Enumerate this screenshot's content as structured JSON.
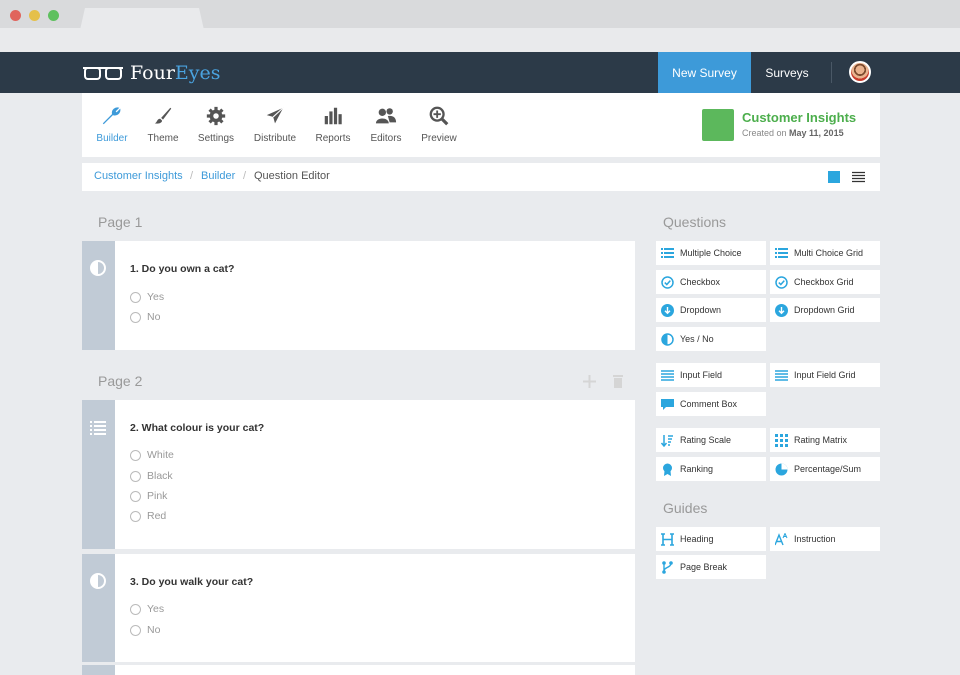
{
  "app": {
    "logo_main": "Four",
    "logo_accent": "Eyes"
  },
  "nav": {
    "new_survey": "New Survey",
    "surveys": "Surveys"
  },
  "toolbar": [
    {
      "label": "Builder",
      "icon": "wrench-icon",
      "active": true
    },
    {
      "label": "Theme",
      "icon": "brush-icon"
    },
    {
      "label": "Settings",
      "icon": "gear-icon"
    },
    {
      "label": "Distribute",
      "icon": "paper-plane-icon"
    },
    {
      "label": "Reports",
      "icon": "bar-chart-icon"
    },
    {
      "label": "Editors",
      "icon": "users-icon"
    },
    {
      "label": "Preview",
      "icon": "magnifier-icon"
    }
  ],
  "survey": {
    "title": "Customer Insights",
    "created_prefix": "Created on ",
    "created_date": "May 11, 2015",
    "color": "#5cb85c"
  },
  "breadcrumb": {
    "items": [
      "Customer Insights",
      "Builder",
      "Question Editor"
    ],
    "separator": "/"
  },
  "pages": [
    {
      "title": "Page 1"
    },
    {
      "title": "Page 2"
    }
  ],
  "questions": [
    {
      "title": "1.  Do you own a cat?",
      "icon": "half-circle-icon",
      "options": [
        "Yes",
        "No"
      ]
    },
    {
      "title": "2.  What colour is your cat?",
      "icon": "list-icon",
      "options": [
        "White",
        "Black",
        "Pink",
        "Red"
      ]
    },
    {
      "title": "3.  Do you walk your cat?",
      "icon": "half-circle-icon",
      "options": [
        "Yes",
        "No"
      ]
    }
  ],
  "sidebar": {
    "questions_title": "Questions",
    "guides_title": "Guides",
    "question_types": [
      {
        "label": "Multiple Choice",
        "icon": "list-icon"
      },
      {
        "label": "Multi Choice Grid",
        "icon": "list-icon"
      },
      {
        "label": "Checkbox",
        "icon": "check-circle-icon"
      },
      {
        "label": "Checkbox Grid",
        "icon": "check-circle-icon"
      },
      {
        "label": "Dropdown",
        "icon": "arrow-down-circle-icon"
      },
      {
        "label": "Dropdown Grid",
        "icon": "arrow-down-circle-icon"
      },
      {
        "label": "Yes / No",
        "icon": "half-circle-icon"
      },
      {
        "label": "Input Field",
        "icon": "lines-icon"
      },
      {
        "label": "Input Field Grid",
        "icon": "lines-icon"
      },
      {
        "label": "Comment Box",
        "icon": "speech-bubble-icon"
      },
      {
        "label": "Rating Scale",
        "icon": "sort-icon"
      },
      {
        "label": "Rating Matrix",
        "icon": "grid-dots-icon"
      },
      {
        "label": "Ranking",
        "icon": "ribbon-icon"
      },
      {
        "label": "Percentage/Sum",
        "icon": "pie-icon"
      }
    ],
    "guide_types": [
      {
        "label": "Heading",
        "icon": "heading-icon"
      },
      {
        "label": "Instruction",
        "icon": "text-size-icon"
      },
      {
        "label": "Page Break",
        "icon": "branch-icon"
      }
    ]
  },
  "colors": {
    "nav_bg": "#2c3a48",
    "accent": "#3d9ad9",
    "icon_blue": "#2ba6de",
    "side_strip": "#c1cbd6"
  }
}
